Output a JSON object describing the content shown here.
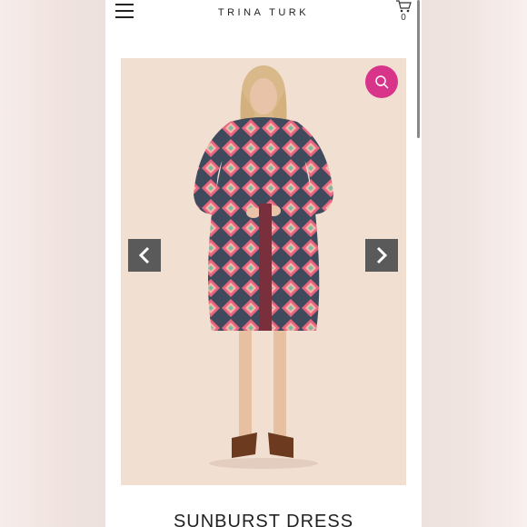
{
  "header": {
    "brand": "TRINA TURK",
    "menu_icon": "hamburger-menu-icon",
    "cart_icon": "cart-icon",
    "cart_count": "0"
  },
  "gallery": {
    "zoom_icon": "search-icon",
    "prev_icon": "chevron-left-icon",
    "next_icon": "chevron-right-icon",
    "accent_color": "#d8358a"
  },
  "product": {
    "title": "SUNBURST DRESS"
  }
}
